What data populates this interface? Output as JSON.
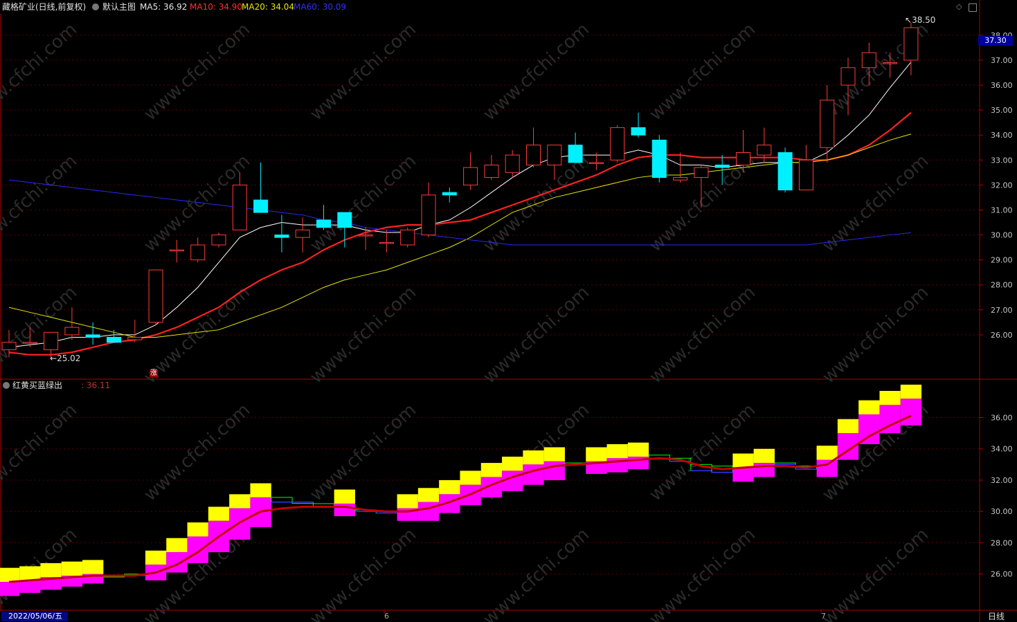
{
  "header": {
    "stock_title": "藏格矿业(日线,前复权)",
    "main_indicator": "默认主图",
    "ma5": "MA5: 36.92",
    "ma10": "MA10: 34.90",
    "ma20": "MA20: 34.04",
    "ma60": "MA60: 30.09"
  },
  "sub_header": {
    "indicator_name": "红黄买蓝绿出",
    "value": ": 36.11"
  },
  "annotations": {
    "high_label": "38.50",
    "low_label": "25.02",
    "current_price": "37.30",
    "zhang_mark": "涨"
  },
  "footer": {
    "date": "2022/05/06/五",
    "month_6": "6",
    "month_7": "7",
    "period": "日线"
  },
  "watermark": "www.cfchi.com",
  "colors": {
    "up": "#ff3b3b",
    "down": "#00f0ff",
    "ma5": "#ffffff",
    "ma10": "#ff2020",
    "ma20": "#e8e800",
    "ma60": "#2828ff",
    "axis": "#b00000",
    "magenta": "#ff00ff",
    "yellow": "#ffff00",
    "green": "#00ff00",
    "blue": "#3030ff",
    "darkred": "#c00000"
  },
  "chart_data": [
    {
      "type": "candlestick",
      "title": "藏格矿业(日线,前复权)",
      "yaxis_ticks": [
        "38.00",
        "37.00",
        "36.00",
        "35.00",
        "34.00",
        "33.00",
        "32.00",
        "31.00",
        "30.00",
        "29.00",
        "28.00",
        "27.00",
        "26.00"
      ],
      "ylim": [
        25.0,
        38.8
      ],
      "candles": [
        {
          "o": 25.4,
          "h": 26.2,
          "l": 25.1,
          "c": 25.7
        },
        {
          "o": 25.7,
          "h": 26.3,
          "l": 25.5,
          "c": 25.7
        },
        {
          "o": 25.4,
          "h": 26.0,
          "l": 25.02,
          "c": 26.1
        },
        {
          "o": 26.0,
          "h": 27.1,
          "l": 25.8,
          "c": 26.3
        },
        {
          "o": 26.0,
          "h": 26.5,
          "l": 25.6,
          "c": 25.9
        },
        {
          "o": 25.9,
          "h": 26.2,
          "l": 25.7,
          "c": 25.7
        },
        {
          "o": 25.8,
          "h": 26.6,
          "l": 25.7,
          "c": 25.9
        },
        {
          "o": 26.5,
          "h": 28.6,
          "l": 26.4,
          "c": 28.6
        },
        {
          "o": 29.4,
          "h": 29.8,
          "l": 28.9,
          "c": 29.4
        },
        {
          "o": 29.0,
          "h": 29.9,
          "l": 28.9,
          "c": 29.6
        },
        {
          "o": 29.6,
          "h": 30.1,
          "l": 29.5,
          "c": 30.0
        },
        {
          "o": 30.2,
          "h": 32.5,
          "l": 30.2,
          "c": 32.0
        },
        {
          "o": 31.4,
          "h": 32.9,
          "l": 30.9,
          "c": 30.9
        },
        {
          "o": 30.0,
          "h": 30.8,
          "l": 29.3,
          "c": 29.9
        },
        {
          "o": 29.9,
          "h": 30.7,
          "l": 29.3,
          "c": 30.2
        },
        {
          "o": 30.6,
          "h": 31.2,
          "l": 30.2,
          "c": 30.3
        },
        {
          "o": 30.9,
          "h": 30.9,
          "l": 29.5,
          "c": 30.3
        },
        {
          "o": 30.0,
          "h": 30.3,
          "l": 29.4,
          "c": 30.0
        },
        {
          "o": 29.7,
          "h": 30.2,
          "l": 29.3,
          "c": 29.7
        },
        {
          "o": 29.6,
          "h": 30.3,
          "l": 29.5,
          "c": 30.2
        },
        {
          "o": 30.0,
          "h": 32.1,
          "l": 29.9,
          "c": 31.6
        },
        {
          "o": 31.7,
          "h": 31.9,
          "l": 31.3,
          "c": 31.6
        },
        {
          "o": 32.0,
          "h": 33.3,
          "l": 31.8,
          "c": 32.7
        },
        {
          "o": 32.3,
          "h": 33.2,
          "l": 32.2,
          "c": 32.8
        },
        {
          "o": 32.5,
          "h": 33.4,
          "l": 32.3,
          "c": 33.2
        },
        {
          "o": 32.8,
          "h": 34.3,
          "l": 32.7,
          "c": 33.6
        },
        {
          "o": 32.8,
          "h": 33.6,
          "l": 32.2,
          "c": 33.6
        },
        {
          "o": 33.6,
          "h": 34.1,
          "l": 33.0,
          "c": 32.9
        },
        {
          "o": 32.9,
          "h": 33.3,
          "l": 32.6,
          "c": 32.9
        },
        {
          "o": 33.0,
          "h": 34.4,
          "l": 32.9,
          "c": 34.3
        },
        {
          "o": 34.3,
          "h": 34.9,
          "l": 33.9,
          "c": 34.0
        },
        {
          "o": 33.8,
          "h": 34.0,
          "l": 32.1,
          "c": 32.3
        },
        {
          "o": 32.2,
          "h": 33.3,
          "l": 32.1,
          "c": 32.3
        },
        {
          "o": 32.3,
          "h": 32.8,
          "l": 31.1,
          "c": 32.7
        },
        {
          "o": 32.8,
          "h": 33.2,
          "l": 32.0,
          "c": 32.7
        },
        {
          "o": 32.8,
          "h": 34.2,
          "l": 32.5,
          "c": 33.3
        },
        {
          "o": 33.2,
          "h": 34.3,
          "l": 32.9,
          "c": 33.6
        },
        {
          "o": 33.3,
          "h": 33.5,
          "l": 31.7,
          "c": 31.8
        },
        {
          "o": 31.8,
          "h": 33.6,
          "l": 31.8,
          "c": 33.0
        },
        {
          "o": 33.5,
          "h": 36.0,
          "l": 32.9,
          "c": 35.4
        },
        {
          "o": 36.0,
          "h": 37.1,
          "l": 34.8,
          "c": 36.7
        },
        {
          "o": 36.7,
          "h": 37.7,
          "l": 36.0,
          "c": 37.3
        },
        {
          "o": 36.9,
          "h": 37.3,
          "l": 36.3,
          "c": 36.9
        },
        {
          "o": 37.0,
          "h": 38.5,
          "l": 36.4,
          "c": 38.3
        }
      ],
      "series": [
        {
          "name": "MA5",
          "values": [
            25.5,
            25.6,
            25.7,
            25.9,
            25.9,
            26.0,
            26.0,
            26.4,
            27.1,
            27.9,
            28.9,
            29.9,
            30.3,
            30.5,
            30.4,
            30.4,
            30.4,
            30.2,
            30.1,
            30.1,
            30.4,
            30.6,
            31.1,
            31.7,
            32.3,
            32.8,
            33.1,
            33.2,
            33.2,
            33.2,
            33.4,
            33.2,
            32.8,
            32.8,
            32.7,
            32.8,
            32.9,
            32.9,
            32.9,
            33.3,
            34.0,
            34.8,
            35.9,
            36.92
          ]
        },
        {
          "name": "MA10",
          "values": [
            25.3,
            25.2,
            25.2,
            25.3,
            25.5,
            25.7,
            25.8,
            26.0,
            26.3,
            26.7,
            27.1,
            27.7,
            28.2,
            28.6,
            28.9,
            29.4,
            29.8,
            30.1,
            30.3,
            30.4,
            30.4,
            30.5,
            30.6,
            30.9,
            31.2,
            31.5,
            31.8,
            32.1,
            32.4,
            32.8,
            33.1,
            33.2,
            33.2,
            33.1,
            33.1,
            33.1,
            33.1,
            33.1,
            33.0,
            33.0,
            33.2,
            33.6,
            34.2,
            34.9
          ]
        },
        {
          "name": "MA20",
          "values": [
            27.1,
            26.9,
            26.7,
            26.5,
            26.3,
            26.1,
            25.9,
            25.9,
            26.0,
            26.1,
            26.2,
            26.5,
            26.8,
            27.1,
            27.5,
            27.9,
            28.2,
            28.4,
            28.6,
            28.9,
            29.2,
            29.5,
            29.9,
            30.4,
            30.9,
            31.2,
            31.5,
            31.7,
            31.9,
            32.1,
            32.3,
            32.4,
            32.4,
            32.5,
            32.6,
            32.7,
            32.8,
            32.9,
            32.9,
            33.0,
            33.2,
            33.5,
            33.8,
            34.04
          ]
        },
        {
          "name": "MA60",
          "values": [
            32.2,
            32.1,
            32.0,
            31.9,
            31.8,
            31.7,
            31.6,
            31.5,
            31.4,
            31.3,
            31.2,
            31.1,
            31.0,
            30.9,
            30.8,
            30.6,
            30.5,
            30.3,
            30.2,
            30.1,
            30.0,
            29.9,
            29.8,
            29.7,
            29.6,
            29.6,
            29.6,
            29.6,
            29.6,
            29.6,
            29.6,
            29.6,
            29.6,
            29.6,
            29.6,
            29.6,
            29.6,
            29.6,
            29.6,
            29.7,
            29.8,
            29.9,
            30.0,
            30.09
          ]
        }
      ]
    },
    {
      "type": "area",
      "title": "红黄买蓝绿出",
      "yaxis_ticks": [
        "36.00",
        "34.00",
        "32.00",
        "30.00",
        "28.00",
        "26.00"
      ],
      "ylim": [
        24.0,
        37.7
      ],
      "steps": [
        {
          "a": 25.5,
          "b": 25.2,
          "k": "buy"
        },
        {
          "a": 25.6,
          "b": 25.4,
          "k": "buy"
        },
        {
          "a": 25.8,
          "b": 25.6,
          "k": "buy"
        },
        {
          "a": 25.9,
          "b": 25.8,
          "k": "buy"
        },
        {
          "a": 26.0,
          "b": 26.0,
          "k": "buy"
        },
        {
          "a": 25.9,
          "b": 25.9,
          "k": "sell"
        },
        {
          "a": 25.9,
          "b": 26.0,
          "k": "sell"
        },
        {
          "a": 26.6,
          "b": 26.2,
          "k": "buy"
        },
        {
          "a": 27.4,
          "b": 26.7,
          "k": "buy"
        },
        {
          "a": 28.4,
          "b": 27.3,
          "k": "buy"
        },
        {
          "a": 29.4,
          "b": 28.0,
          "k": "buy"
        },
        {
          "a": 30.2,
          "b": 28.8,
          "k": "buy"
        },
        {
          "a": 30.9,
          "b": 29.6,
          "k": "buy"
        },
        {
          "a": 30.6,
          "b": 30.9,
          "k": "sell"
        },
        {
          "a": 30.6,
          "b": 30.6,
          "k": "sell"
        },
        {
          "a": 30.3,
          "b": 30.5,
          "k": "sell"
        },
        {
          "a": 30.5,
          "b": 30.3,
          "k": "buy"
        },
        {
          "a": 30.1,
          "b": 30.0,
          "k": "sell"
        },
        {
          "a": 30.0,
          "b": 29.9,
          "k": "sell"
        },
        {
          "a": 30.2,
          "b": 30.0,
          "k": "buy"
        },
        {
          "a": 30.6,
          "b": 30.0,
          "k": "buy"
        },
        {
          "a": 31.1,
          "b": 30.5,
          "k": "buy"
        },
        {
          "a": 31.7,
          "b": 31.0,
          "k": "buy"
        },
        {
          "a": 32.2,
          "b": 31.5,
          "k": "buy"
        },
        {
          "a": 32.6,
          "b": 31.9,
          "k": "buy"
        },
        {
          "a": 33.0,
          "b": 32.3,
          "k": "buy"
        },
        {
          "a": 33.2,
          "b": 32.6,
          "k": "buy"
        },
        {
          "a": 33.1,
          "b": 33.0,
          "k": "sell"
        },
        {
          "a": 33.2,
          "b": 33.0,
          "k": "buy"
        },
        {
          "a": 33.4,
          "b": 33.1,
          "k": "buy"
        },
        {
          "a": 33.5,
          "b": 33.3,
          "k": "buy"
        },
        {
          "a": 33.4,
          "b": 33.6,
          "k": "sell"
        },
        {
          "a": 33.2,
          "b": 33.4,
          "k": "sell"
        },
        {
          "a": 32.6,
          "b": 33.0,
          "k": "sell"
        },
        {
          "a": 32.5,
          "b": 32.9,
          "k": "sell"
        },
        {
          "a": 32.8,
          "b": 32.5,
          "k": "buy"
        },
        {
          "a": 33.1,
          "b": 32.8,
          "k": "buy"
        },
        {
          "a": 33.0,
          "b": 33.1,
          "k": "sell"
        },
        {
          "a": 32.7,
          "b": 32.9,
          "k": "sell"
        },
        {
          "a": 33.3,
          "b": 32.8,
          "k": "buy"
        },
        {
          "a": 35.0,
          "b": 33.9,
          "k": "buy"
        },
        {
          "a": 36.2,
          "b": 34.9,
          "k": "buy"
        },
        {
          "a": 36.8,
          "b": 35.6,
          "k": "buy"
        },
        {
          "a": 37.2,
          "b": 36.1,
          "k": "buy"
        }
      ],
      "line": [
        25.5,
        25.6,
        25.7,
        25.8,
        25.9,
        25.9,
        25.9,
        26.1,
        26.6,
        27.4,
        28.4,
        29.3,
        30.0,
        30.2,
        30.3,
        30.3,
        30.3,
        30.1,
        30.0,
        30.0,
        30.2,
        30.6,
        31.1,
        31.7,
        32.2,
        32.6,
        32.9,
        33.0,
        33.1,
        33.2,
        33.3,
        33.4,
        33.3,
        32.9,
        32.7,
        32.8,
        32.9,
        32.9,
        32.8,
        33.0,
        33.9,
        34.8,
        35.5,
        36.11
      ]
    }
  ]
}
